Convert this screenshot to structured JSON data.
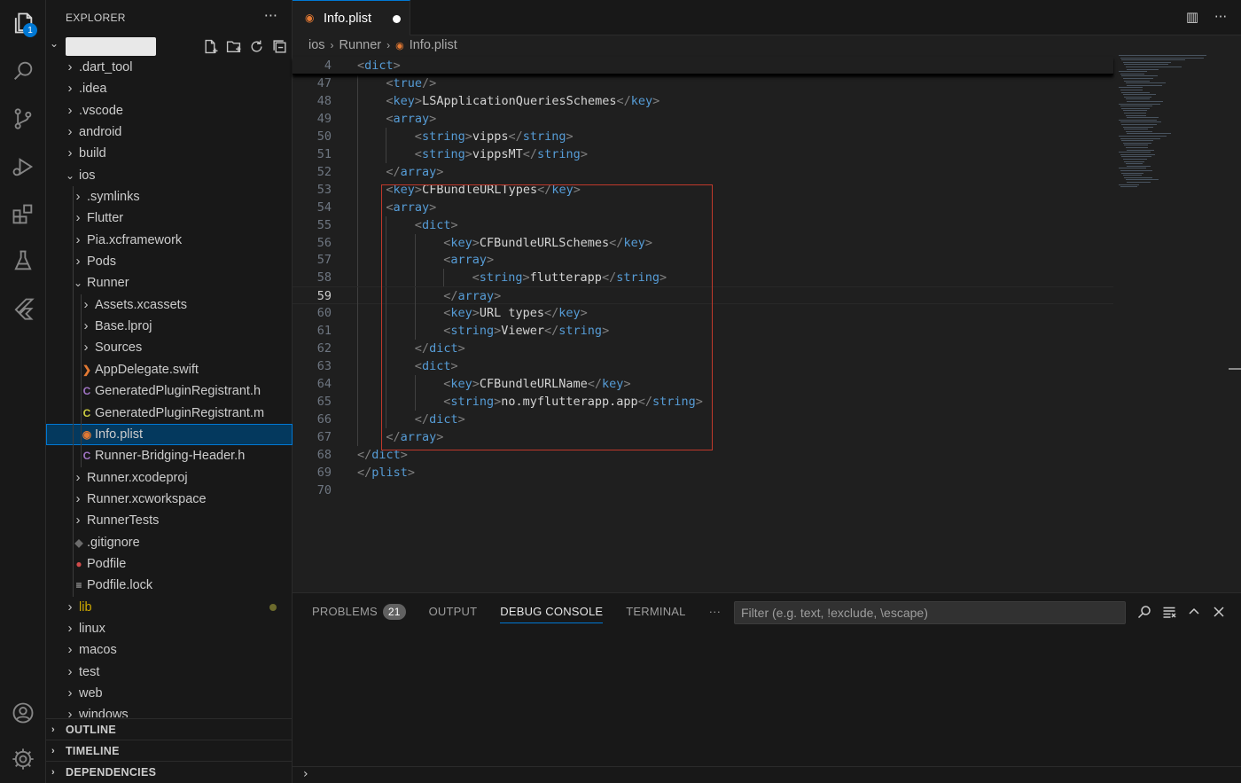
{
  "activity_bar": {
    "explorer_badge": "1",
    "icons": [
      "files-icon",
      "search-icon",
      "source-control-icon",
      "run-debug-icon",
      "extensions-icon",
      "testing-icon",
      "flutter-icon",
      "account-icon",
      "gear-icon"
    ]
  },
  "sidebar": {
    "title": "EXPLORER",
    "more": "···",
    "tree": [
      {
        "label": ".dart_tool",
        "type": "folder",
        "depth": 0,
        "open": false
      },
      {
        "label": ".idea",
        "type": "folder",
        "depth": 0,
        "open": false
      },
      {
        "label": ".vscode",
        "type": "folder",
        "depth": 0,
        "open": false
      },
      {
        "label": "android",
        "type": "folder",
        "depth": 0,
        "open": false
      },
      {
        "label": "build",
        "type": "folder",
        "depth": 0,
        "open": false
      },
      {
        "label": "ios",
        "type": "folder",
        "depth": 0,
        "open": true
      },
      {
        "label": ".symlinks",
        "type": "folder",
        "depth": 1,
        "open": false
      },
      {
        "label": "Flutter",
        "type": "folder",
        "depth": 1,
        "open": false
      },
      {
        "label": "Pia.xcframework",
        "type": "folder",
        "depth": 1,
        "open": false
      },
      {
        "label": "Pods",
        "type": "folder",
        "depth": 1,
        "open": false
      },
      {
        "label": "Runner",
        "type": "folder",
        "depth": 1,
        "open": true
      },
      {
        "label": "Assets.xcassets",
        "type": "folder",
        "depth": 2,
        "open": false
      },
      {
        "label": "Base.lproj",
        "type": "folder",
        "depth": 2,
        "open": false
      },
      {
        "label": "Sources",
        "type": "folder",
        "depth": 2,
        "open": false
      },
      {
        "label": "AppDelegate.swift",
        "type": "swift",
        "depth": 2
      },
      {
        "label": "GeneratedPluginRegistrant.h",
        "type": "c-header",
        "depth": 2
      },
      {
        "label": "GeneratedPluginRegistrant.m",
        "type": "c-source",
        "depth": 2
      },
      {
        "label": "Info.plist",
        "type": "plist",
        "depth": 2,
        "selected": true
      },
      {
        "label": "Runner-Bridging-Header.h",
        "type": "c-header",
        "depth": 2
      },
      {
        "label": "Runner.xcodeproj",
        "type": "folder",
        "depth": 1,
        "open": false
      },
      {
        "label": "Runner.xcworkspace",
        "type": "folder",
        "depth": 1,
        "open": false
      },
      {
        "label": "RunnerTests",
        "type": "folder",
        "depth": 1,
        "open": false
      },
      {
        "label": ".gitignore",
        "type": "git",
        "depth": 1
      },
      {
        "label": "Podfile",
        "type": "ruby",
        "depth": 1
      },
      {
        "label": "Podfile.lock",
        "type": "lines",
        "depth": 1
      },
      {
        "label": "lib",
        "type": "folder",
        "depth": 0,
        "open": false,
        "modified": true
      },
      {
        "label": "linux",
        "type": "folder",
        "depth": 0,
        "open": false
      },
      {
        "label": "macos",
        "type": "folder",
        "depth": 0,
        "open": false
      },
      {
        "label": "test",
        "type": "folder",
        "depth": 0,
        "open": false
      },
      {
        "label": "web",
        "type": "folder",
        "depth": 0,
        "open": false
      },
      {
        "label": "windows",
        "type": "folder",
        "depth": 0,
        "open": false
      }
    ],
    "sections": [
      "OUTLINE",
      "TIMELINE",
      "DEPENDENCIES"
    ]
  },
  "editor": {
    "tab_label": "Info.plist",
    "breadcrumb": [
      "ios",
      "Runner",
      "Info.plist"
    ],
    "current_line": 59,
    "lines": [
      {
        "n": "4",
        "indent": 0,
        "tokens": [
          [
            "g",
            "<"
          ],
          [
            "n",
            "dict"
          ],
          [
            "g",
            ">"
          ]
        ],
        "sticky": true
      },
      {
        "n": "47",
        "indent": 2,
        "tokens": [
          [
            "g",
            "<"
          ],
          [
            "n",
            "true"
          ],
          [
            "g",
            "/>"
          ]
        ]
      },
      {
        "n": "48",
        "indent": 2,
        "tokens": [
          [
            "g",
            "<"
          ],
          [
            "n",
            "key"
          ],
          [
            "g",
            ">"
          ],
          [
            "x",
            "LSApplicationQueriesSchemes"
          ],
          [
            "g",
            "</"
          ],
          [
            "n",
            "key"
          ],
          [
            "g",
            ">"
          ]
        ]
      },
      {
        "n": "49",
        "indent": 2,
        "tokens": [
          [
            "g",
            "<"
          ],
          [
            "n",
            "array"
          ],
          [
            "g",
            ">"
          ]
        ]
      },
      {
        "n": "50",
        "indent": 4,
        "tokens": [
          [
            "g",
            "<"
          ],
          [
            "n",
            "string"
          ],
          [
            "g",
            ">"
          ],
          [
            "x",
            "vipps"
          ],
          [
            "g",
            "</"
          ],
          [
            "n",
            "string"
          ],
          [
            "g",
            ">"
          ]
        ]
      },
      {
        "n": "51",
        "indent": 4,
        "tokens": [
          [
            "g",
            "<"
          ],
          [
            "n",
            "string"
          ],
          [
            "g",
            ">"
          ],
          [
            "x",
            "vippsMT"
          ],
          [
            "g",
            "</"
          ],
          [
            "n",
            "string"
          ],
          [
            "g",
            ">"
          ]
        ]
      },
      {
        "n": "52",
        "indent": 2,
        "tokens": [
          [
            "g",
            "</"
          ],
          [
            "n",
            "array"
          ],
          [
            "g",
            ">"
          ]
        ]
      },
      {
        "n": "53",
        "indent": 2,
        "tokens": [
          [
            "g",
            "<"
          ],
          [
            "n",
            "key"
          ],
          [
            "g",
            ">"
          ],
          [
            "x",
            "CFBundleURLTypes"
          ],
          [
            "g",
            "</"
          ],
          [
            "n",
            "key"
          ],
          [
            "g",
            ">"
          ]
        ]
      },
      {
        "n": "54",
        "indent": 2,
        "tokens": [
          [
            "g",
            "<"
          ],
          [
            "n",
            "array"
          ],
          [
            "g",
            ">"
          ]
        ]
      },
      {
        "n": "55",
        "indent": 4,
        "tokens": [
          [
            "g",
            "<"
          ],
          [
            "n",
            "dict"
          ],
          [
            "g",
            ">"
          ]
        ]
      },
      {
        "n": "56",
        "indent": 6,
        "tokens": [
          [
            "g",
            "<"
          ],
          [
            "n",
            "key"
          ],
          [
            "g",
            ">"
          ],
          [
            "x",
            "CFBundleURLSchemes"
          ],
          [
            "g",
            "</"
          ],
          [
            "n",
            "key"
          ],
          [
            "g",
            ">"
          ]
        ]
      },
      {
        "n": "57",
        "indent": 6,
        "tokens": [
          [
            "g",
            "<"
          ],
          [
            "n",
            "array"
          ],
          [
            "g",
            ">"
          ]
        ]
      },
      {
        "n": "58",
        "indent": 8,
        "tokens": [
          [
            "g",
            "<"
          ],
          [
            "n",
            "string"
          ],
          [
            "g",
            ">"
          ],
          [
            "x",
            "flutterapp"
          ],
          [
            "g",
            "</"
          ],
          [
            "n",
            "string"
          ],
          [
            "g",
            ">"
          ]
        ]
      },
      {
        "n": "59",
        "indent": 6,
        "tokens": [
          [
            "g",
            "</"
          ],
          [
            "n",
            "array"
          ],
          [
            "g",
            ">"
          ]
        ]
      },
      {
        "n": "60",
        "indent": 6,
        "tokens": [
          [
            "g",
            "<"
          ],
          [
            "n",
            "key"
          ],
          [
            "g",
            ">"
          ],
          [
            "x",
            "URL types"
          ],
          [
            "g",
            "</"
          ],
          [
            "n",
            "key"
          ],
          [
            "g",
            ">"
          ]
        ]
      },
      {
        "n": "61",
        "indent": 6,
        "tokens": [
          [
            "g",
            "<"
          ],
          [
            "n",
            "string"
          ],
          [
            "g",
            ">"
          ],
          [
            "x",
            "Viewer"
          ],
          [
            "g",
            "</"
          ],
          [
            "n",
            "string"
          ],
          [
            "g",
            ">"
          ]
        ]
      },
      {
        "n": "62",
        "indent": 4,
        "tokens": [
          [
            "g",
            "</"
          ],
          [
            "n",
            "dict"
          ],
          [
            "g",
            ">"
          ]
        ]
      },
      {
        "n": "63",
        "indent": 4,
        "tokens": [
          [
            "g",
            "<"
          ],
          [
            "n",
            "dict"
          ],
          [
            "g",
            ">"
          ]
        ]
      },
      {
        "n": "64",
        "indent": 6,
        "tokens": [
          [
            "g",
            "<"
          ],
          [
            "n",
            "key"
          ],
          [
            "g",
            ">"
          ],
          [
            "x",
            "CFBundleURLName"
          ],
          [
            "g",
            "</"
          ],
          [
            "n",
            "key"
          ],
          [
            "g",
            ">"
          ]
        ]
      },
      {
        "n": "65",
        "indent": 6,
        "tokens": [
          [
            "g",
            "<"
          ],
          [
            "n",
            "string"
          ],
          [
            "g",
            ">"
          ],
          [
            "x",
            "no.myflutterapp.app"
          ],
          [
            "g",
            "</"
          ],
          [
            "n",
            "string"
          ],
          [
            "g",
            ">"
          ]
        ]
      },
      {
        "n": "66",
        "indent": 4,
        "tokens": [
          [
            "g",
            "</"
          ],
          [
            "n",
            "dict"
          ],
          [
            "g",
            ">"
          ]
        ]
      },
      {
        "n": "67",
        "indent": 2,
        "tokens": [
          [
            "g",
            "</"
          ],
          [
            "n",
            "array"
          ],
          [
            "g",
            ">"
          ]
        ]
      },
      {
        "n": "68",
        "indent": 0,
        "tokens": [
          [
            "g",
            "</"
          ],
          [
            "n",
            "dict"
          ],
          [
            "g",
            ">"
          ]
        ]
      },
      {
        "n": "69",
        "indent": 0,
        "tokens": [
          [
            "g",
            "</"
          ],
          [
            "n",
            "plist"
          ],
          [
            "g",
            ">"
          ]
        ]
      },
      {
        "n": "70",
        "indent": 0,
        "tokens": []
      }
    ]
  },
  "panel": {
    "tabs": [
      {
        "label": "PROBLEMS",
        "badge": "21"
      },
      {
        "label": "OUTPUT"
      },
      {
        "label": "DEBUG CONSOLE",
        "active": true
      },
      {
        "label": "TERMINAL"
      }
    ],
    "more": "···",
    "filter_placeholder": "Filter (e.g. text, !exclude, \\escape)",
    "prompt": "›"
  },
  "colors": {
    "accent": "#0078d4",
    "tag_name": "#569cd6",
    "tag_bracket": "#808080",
    "highlight_box": "#c0392b",
    "plist_icon": "#e37933",
    "c_icon": "#a074c4",
    "m_icon": "#cbcb41",
    "swift_icon": "#e37933",
    "ruby_icon": "#d04b4b"
  }
}
